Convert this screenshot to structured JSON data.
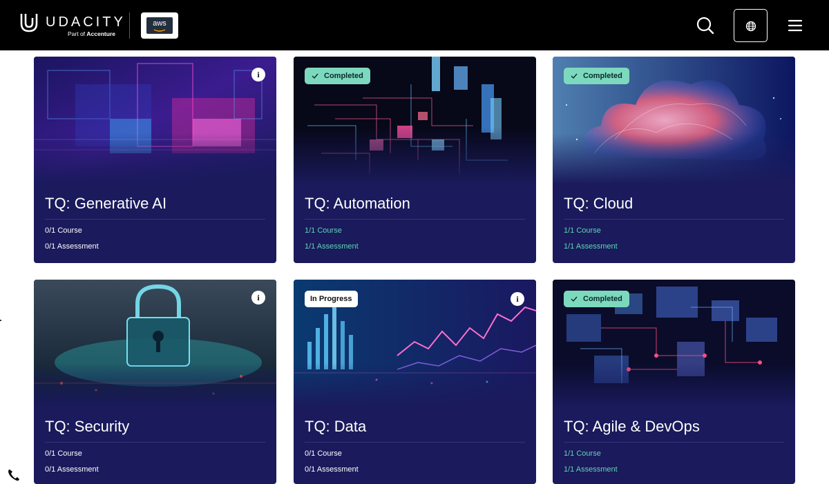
{
  "header": {
    "brand": "UDACITY",
    "brand_sub_prefix": "Part of",
    "brand_sub_name": "Accenture",
    "partner_logo_text": "aws"
  },
  "colors": {
    "topbar": "#000000",
    "card_bg": "#1a1a5c",
    "completed_badge": "#7dd9bd",
    "completed_text": "#5fd6b4"
  },
  "cards": [
    {
      "title": "TQ: Generative AI",
      "course": "0/1 Course",
      "assessment": "0/1 Assessment",
      "badge": "",
      "status": "not-started",
      "info": true,
      "image": "generative-ai-art"
    },
    {
      "title": "TQ: Automation",
      "course": "1/1 Course",
      "assessment": "1/1 Assessment",
      "badge": "Completed",
      "status": "completed",
      "info": false,
      "image": "automation-art"
    },
    {
      "title": "TQ: Cloud",
      "course": "1/1 Course",
      "assessment": "1/1 Assessment",
      "badge": "Completed",
      "status": "completed",
      "info": false,
      "image": "cloud-art"
    },
    {
      "title": "TQ: Security",
      "course": "0/1 Course",
      "assessment": "0/1 Assessment",
      "badge": "",
      "status": "not-started",
      "info": true,
      "image": "security-lock-art"
    },
    {
      "title": "TQ: Data",
      "course": "0/1 Course",
      "assessment": "0/1 Assessment",
      "badge": "In Progress",
      "status": "in-progress",
      "info": true,
      "image": "data-chart-art"
    },
    {
      "title": "TQ: Agile & DevOps",
      "course": "1/1 Course",
      "assessment": "1/1 Assessment",
      "badge": "Completed",
      "status": "completed",
      "info": false,
      "image": "agile-devops-art"
    }
  ]
}
